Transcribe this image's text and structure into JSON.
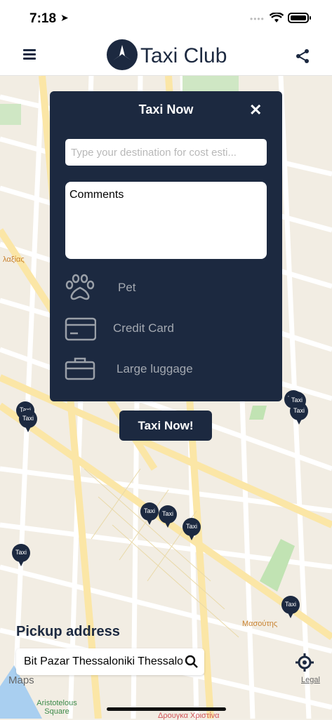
{
  "status_bar": {
    "time": "7:18"
  },
  "header": {
    "brand": "Taxi Club"
  },
  "modal": {
    "title": "Taxi Now",
    "destination_placeholder": "Type your destination for cost esti...",
    "comments_value": "Comments",
    "options": [
      {
        "label": "Pet",
        "icon": "paw-icon"
      },
      {
        "label": "Credit Card",
        "icon": "credit-card-icon"
      },
      {
        "label": "Large luggage",
        "icon": "briefcase-icon"
      }
    ]
  },
  "taxi_now_button": "Taxi Now!",
  "pickup": {
    "title": "Pickup address",
    "value": "Bit Pazar Thessaloniki Thessaloniki"
  },
  "map": {
    "attribution": "Maps",
    "legal": "Legal",
    "taxi_marker_label": "Taxi",
    "poi_labels": [
      "λαξίας",
      "Μασούτης",
      "Aristotelous Square",
      "Δρουγκα Χριστίνα"
    ]
  },
  "colors": {
    "primary": "#1c2940",
    "map_bg": "#f2ede3",
    "road": "#fbe6a6"
  }
}
